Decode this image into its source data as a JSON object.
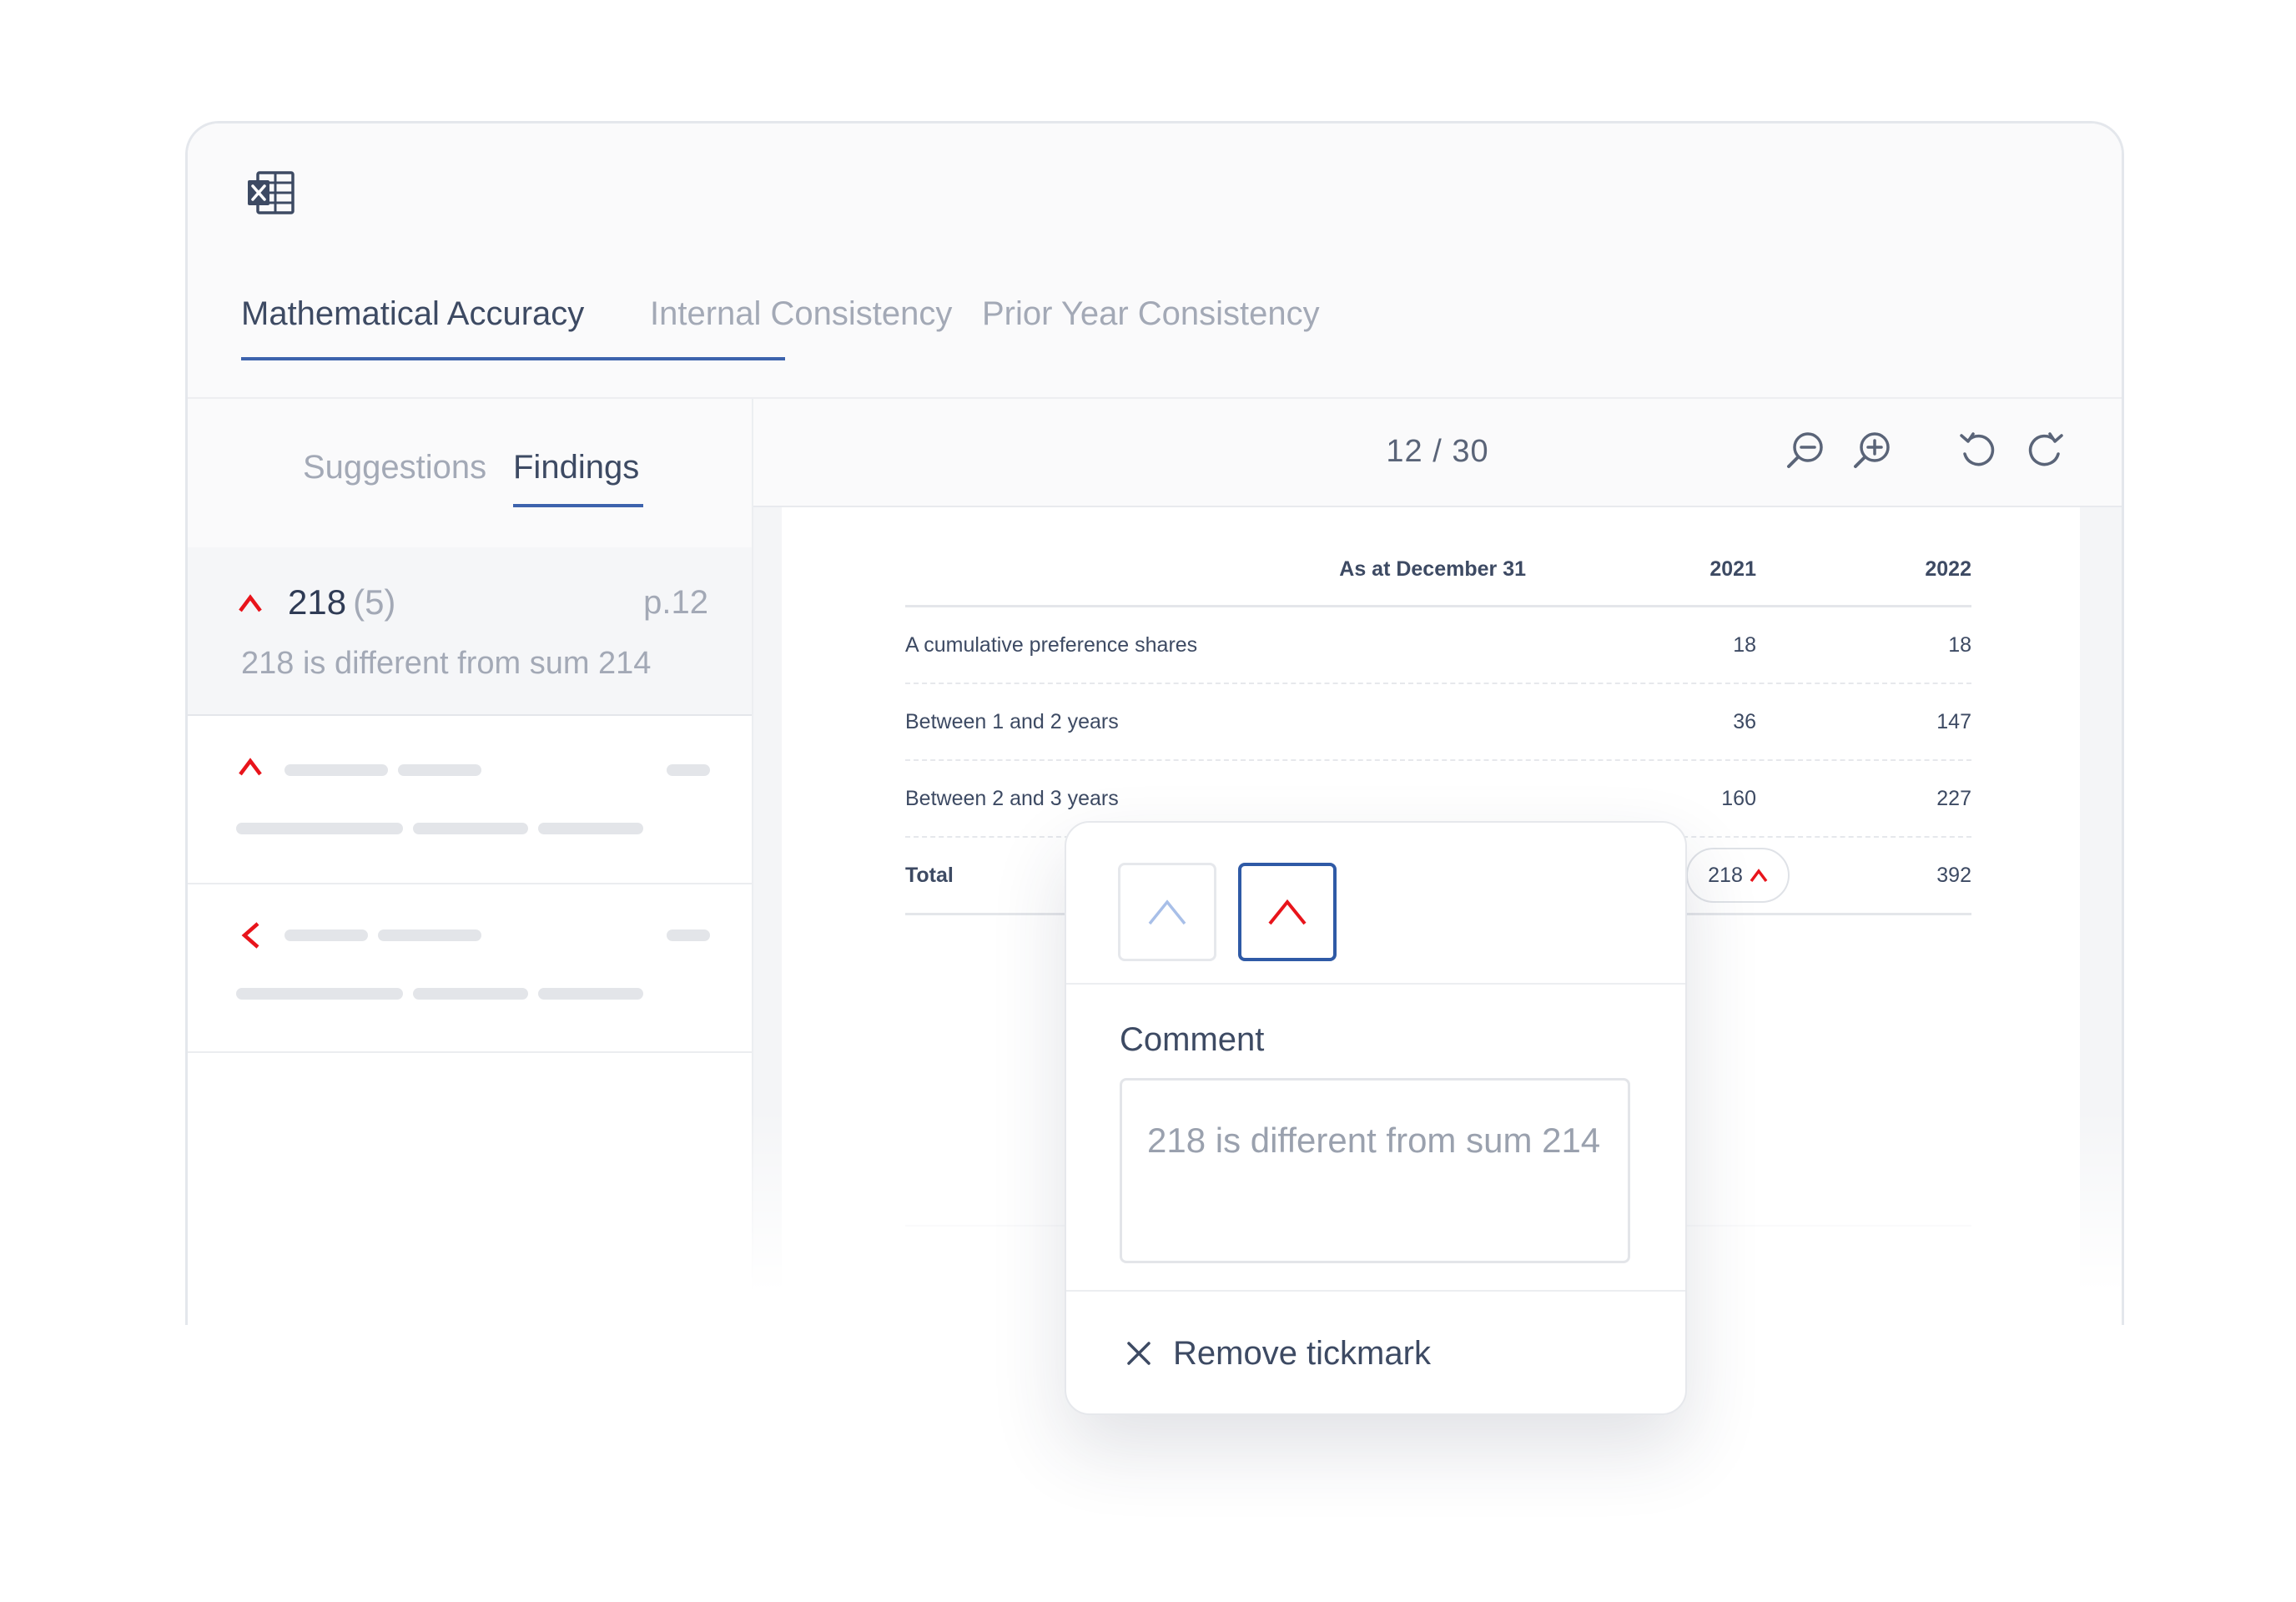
{
  "app": {
    "icon": "excel-icon"
  },
  "tabs": [
    {
      "label": "Mathematical Accuracy",
      "active": true
    },
    {
      "label": "Internal Consistency",
      "active": false
    },
    {
      "label": "Prior Year Consistency",
      "active": false
    }
  ],
  "subtabs": [
    {
      "label": "Suggestions",
      "active": false
    },
    {
      "label": "Findings",
      "active": true
    }
  ],
  "findings": {
    "selected": {
      "icon": "caret-up-icon",
      "value": "218",
      "count": "(5)",
      "page": "p.12",
      "description": "218 is different from sum 214"
    },
    "placeholders": [
      {
        "icon": "caret-up-icon"
      },
      {
        "icon": "caret-left-icon"
      }
    ]
  },
  "viewer": {
    "page_indicator": "12 / 30",
    "controls": [
      "zoom-out-icon",
      "zoom-in-icon",
      "rotate-left-icon",
      "rotate-right-icon"
    ]
  },
  "table": {
    "headers": [
      "As at December 31",
      "2021",
      "2022"
    ],
    "rows": [
      {
        "label": "A cumulative preference shares",
        "v2021": "18",
        "v2022": "18"
      },
      {
        "label": "Between 1 and 2 years",
        "v2021": "36",
        "v2022": "147"
      },
      {
        "label": "Between 2 and 3 years",
        "v2021": "160",
        "v2022": "227"
      }
    ],
    "total": {
      "label": "Total",
      "v2021": "218",
      "v2022": "392"
    }
  },
  "popover": {
    "tickmark_options": [
      "caret-up-outline-icon",
      "caret-up-red-icon"
    ],
    "selected_option": 1,
    "comment_label": "Comment",
    "comment_text": "218 is different from sum 214",
    "remove_label": "Remove tickmark"
  },
  "colors": {
    "accent": "#3d63ad",
    "tickmark_red": "#e8141b",
    "text_primary": "#3d4a63",
    "text_muted": "#a3a9b6"
  }
}
